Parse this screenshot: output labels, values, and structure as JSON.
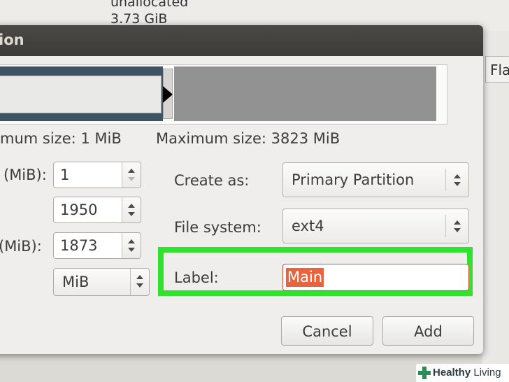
{
  "background": {
    "unallocated_label": "unallocated",
    "unallocated_size": "3.73 GiB",
    "flags_header": "Fla"
  },
  "dialog": {
    "title": "tion",
    "min_size_label": "mum size: 1 MiB",
    "max_size_label": "Maximum size: 3823 MiB",
    "fields": {
      "free_before_label": "(MiB):",
      "free_before_value": "1",
      "new_size_value": "1950",
      "free_after_label": "(MiB):",
      "free_after_value": "1873",
      "unit_value": "MiB"
    },
    "create_as_label": "Create as:",
    "create_as_value": "Primary Partition",
    "file_system_label": "File system:",
    "file_system_value": "ext4",
    "label_label": "Label:",
    "label_value": "Main",
    "cancel_label": "Cancel",
    "add_label": "Add"
  },
  "watermark": {
    "bold": "Healthy",
    "rest": " Living"
  },
  "colors": {
    "highlight": "#2ee22e",
    "selection": "#e9643c",
    "titlebar": "#3c3b37",
    "used_partition": "#3e5363",
    "free_space": "#929292"
  }
}
